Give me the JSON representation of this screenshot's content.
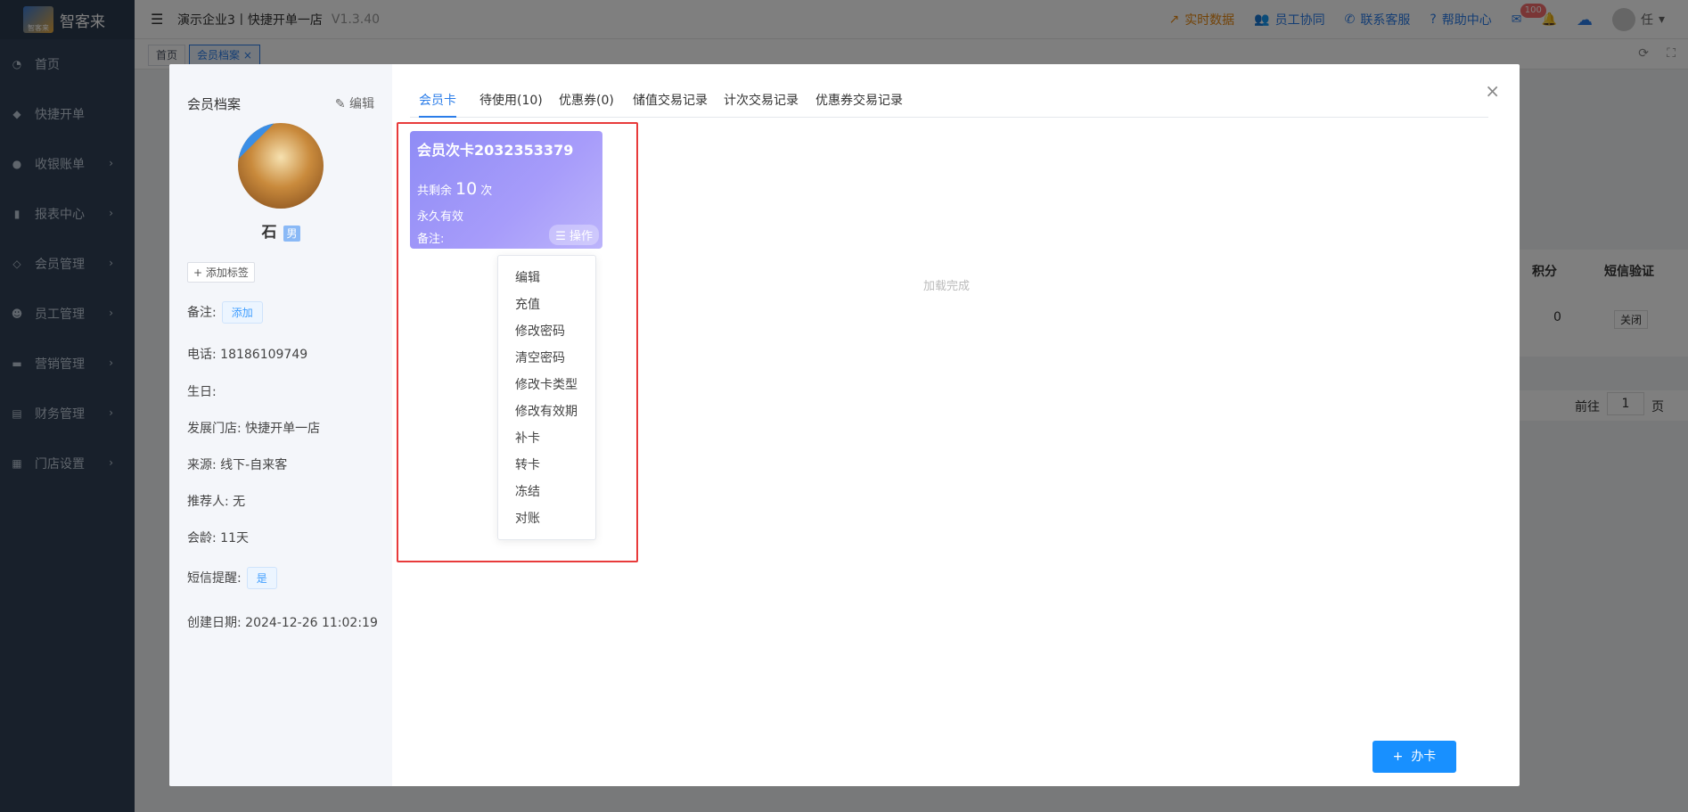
{
  "app": {
    "logo_text": "智客来",
    "logo_small": "智客来"
  },
  "sidebar": {
    "items": [
      {
        "label": "首页",
        "icon": "dashboard-icon",
        "chevron": false
      },
      {
        "label": "快捷开单",
        "icon": "bag-icon",
        "chevron": false
      },
      {
        "label": "收银账单",
        "icon": "money-bag-icon",
        "chevron": true
      },
      {
        "label": "报表中心",
        "icon": "bar-chart-icon",
        "chevron": true
      },
      {
        "label": "会员管理",
        "icon": "diamond-icon",
        "chevron": true
      },
      {
        "label": "员工管理",
        "icon": "user-icon",
        "chevron": true
      },
      {
        "label": "营销管理",
        "icon": "briefcase-icon",
        "chevron": true
      },
      {
        "label": "财务管理",
        "icon": "wallet-icon",
        "chevron": true
      },
      {
        "label": "门店设置",
        "icon": "grid-icon",
        "chevron": true
      }
    ]
  },
  "topbar": {
    "title": "演示企业3丨快捷开单一店",
    "version": "V1.3.40",
    "realtime": "实时数据",
    "staff": "员工协同",
    "contact": "联系客服",
    "help": "帮助中心",
    "mail_badge": "100",
    "user": "任"
  },
  "tabbar": {
    "home": "首页",
    "current": "会员档案",
    "close": "×"
  },
  "background": {
    "points_header": "积分",
    "sms_header": "短信验证",
    "points_value": "0",
    "sms_value": "关闭",
    "goto": "前往",
    "page_num": "1",
    "page_unit": "页"
  },
  "profile": {
    "header": "会员档案",
    "edit": "编辑",
    "name": "石",
    "sex": "男",
    "add_tag": "+ 添加标签",
    "remark_label": "备注:",
    "remark_add": "添加",
    "phone": "电话:  18186109749",
    "birthday": "生日:",
    "store": "发展门店:  快捷开单一店",
    "source": "来源:  线下-自来客",
    "referrer": "推荐人:  无",
    "age": "会龄:  11天",
    "sms_label": "短信提醒:",
    "sms_value": "是",
    "created": "创建日期:  2024-12-26 11:02:19"
  },
  "tabs": [
    {
      "label": "会员卡",
      "active": true
    },
    {
      "label": "待使用(10)",
      "active": false
    },
    {
      "label": "优惠券(0)",
      "active": false
    },
    {
      "label": "储值交易记录",
      "active": false
    },
    {
      "label": "计次交易记录",
      "active": false
    },
    {
      "label": "优惠券交易记录",
      "active": false
    }
  ],
  "card": {
    "name": "会员次卡2032353379",
    "remain_prefix": "共剩余",
    "remain_value": "10",
    "remain_unit": "次",
    "valid": "永久有效",
    "note": "备注:",
    "op": "操作"
  },
  "dropdown": [
    "编辑",
    "充值",
    "修改密码",
    "清空密码",
    "修改卡类型",
    "修改有效期",
    "补卡",
    "转卡",
    "冻结",
    "对账"
  ],
  "status": "加载完成",
  "button": {
    "icon": "+",
    "label": "办卡"
  },
  "colors": {
    "accent": "#2b7de9",
    "card": "#9d97f8",
    "highlight": "#e83b3b",
    "sidebar": "#304156"
  }
}
